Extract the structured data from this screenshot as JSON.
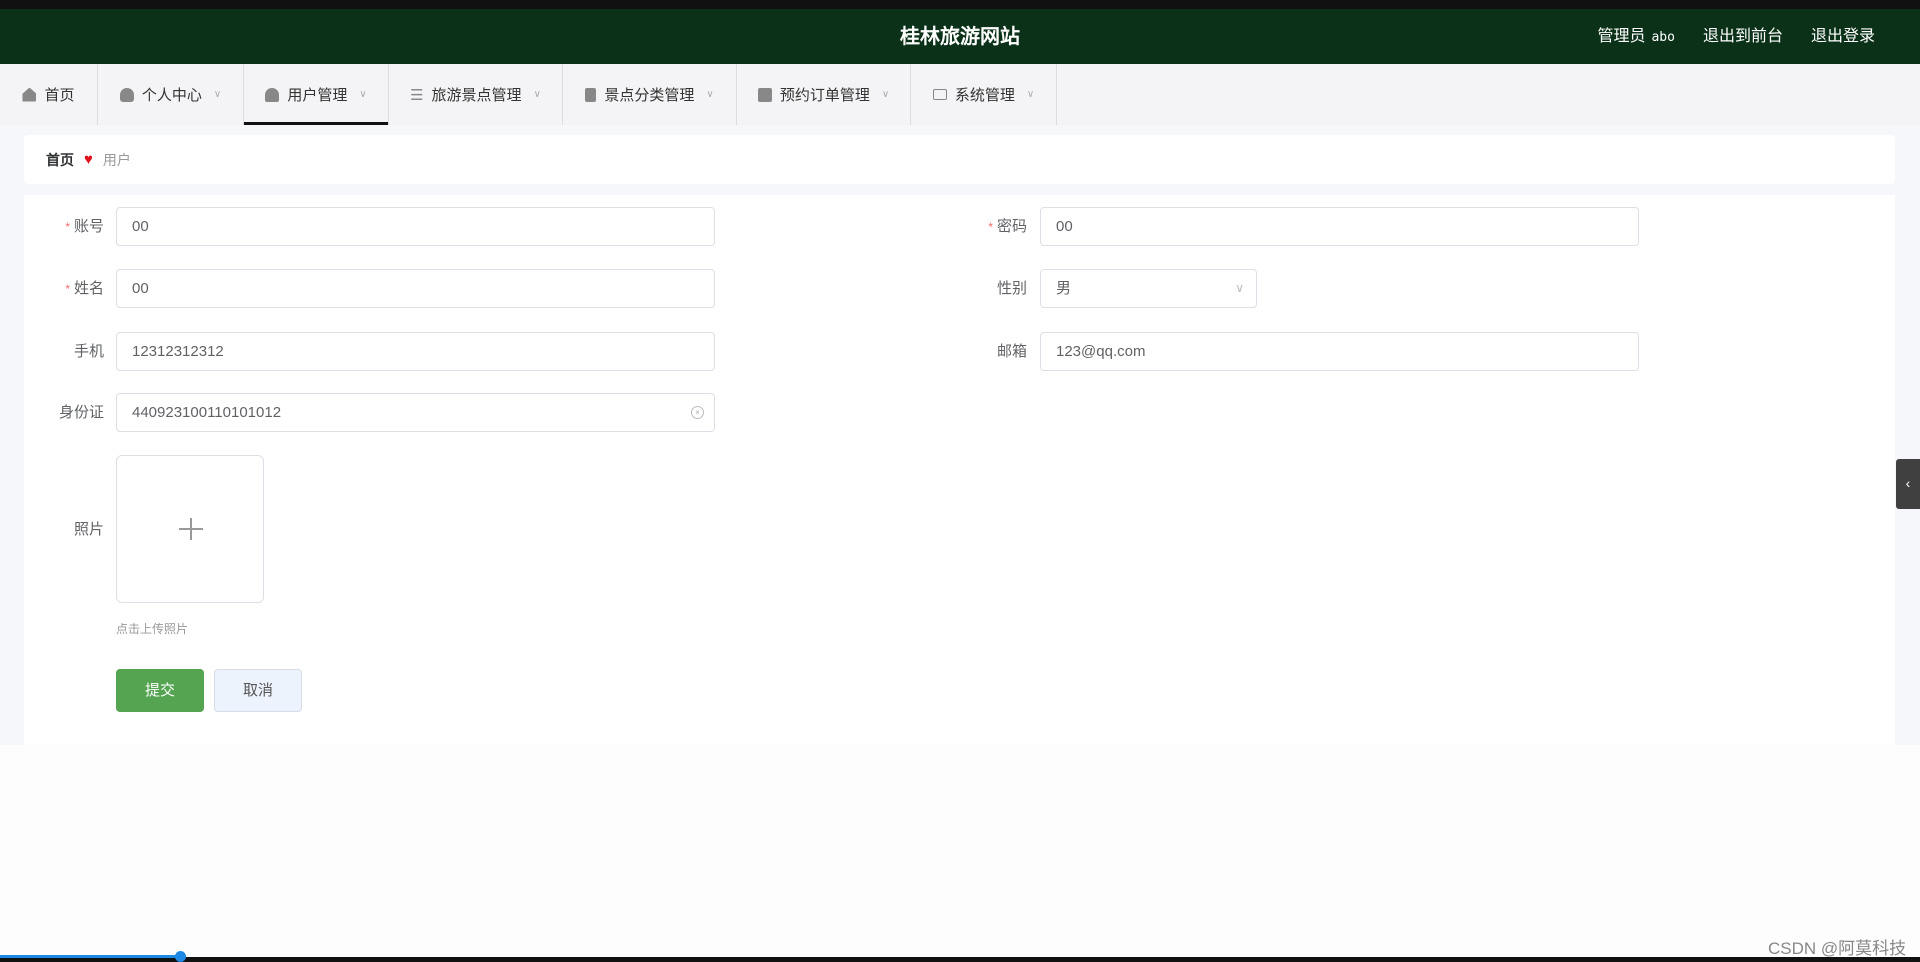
{
  "header": {
    "title": "桂林旅游网站",
    "role": "管理员",
    "username": "abo",
    "front_link": "退出到前台",
    "logout": "退出登录"
  },
  "nav": [
    {
      "label": "首页",
      "icon": "home-icon"
    },
    {
      "label": "个人中心",
      "icon": "user-icon"
    },
    {
      "label": "用户管理",
      "icon": "user-stamp-icon",
      "active": true
    },
    {
      "label": "旅游景点管理",
      "icon": "sliders-icon"
    },
    {
      "label": "景点分类管理",
      "icon": "clipboard-icon"
    },
    {
      "label": "预约订单管理",
      "icon": "printer-icon"
    },
    {
      "label": "系统管理",
      "icon": "card-icon"
    }
  ],
  "breadcrumb": {
    "home": "首页",
    "current": "用户"
  },
  "form": {
    "account": {
      "label": "账号",
      "value": "00",
      "required": "*"
    },
    "password": {
      "label": "密码",
      "value": "00",
      "required": "*"
    },
    "name": {
      "label": "姓名",
      "value": "00",
      "required": "*"
    },
    "gender": {
      "label": "性别",
      "value": "男"
    },
    "phone": {
      "label": "手机",
      "value": "12312312312"
    },
    "email": {
      "label": "邮箱",
      "value": "123@qq.com"
    },
    "idcard": {
      "label": "身份证",
      "value": "440923100110101012"
    },
    "photo": {
      "label": "照片",
      "hint": "点击上传照片"
    },
    "submit": "提交",
    "cancel": "取消"
  },
  "watermark": "CSDN @阿莫科技",
  "colors": {
    "header": "#0b3219",
    "submit": "#54a452",
    "required": "#f56c6c"
  }
}
